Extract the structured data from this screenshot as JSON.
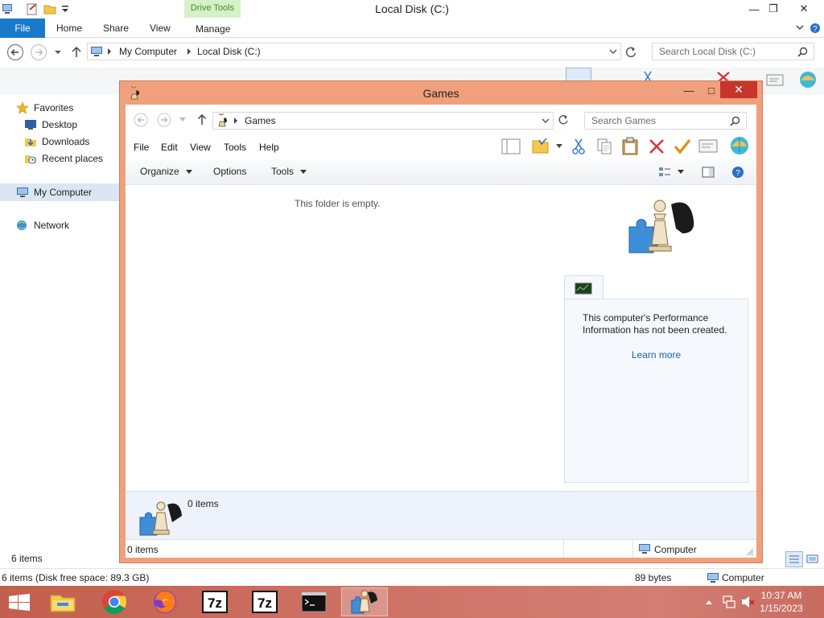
{
  "background_window": {
    "title": "Local Disk (C:)",
    "ribbon": {
      "file_tab": "File",
      "tabs": [
        "Home",
        "Share",
        "View",
        "Manage"
      ],
      "contextual_group": "Drive Tools"
    },
    "address": {
      "crumbs": [
        "My Computer",
        "Local Disk (C:)"
      ],
      "search_placeholder": "Search Local Disk (C:)"
    },
    "nav": {
      "favorites": "Favorites",
      "desktop": "Desktop",
      "downloads": "Downloads",
      "recent_places": "Recent places",
      "my_computer": "My Computer",
      "network": "Network"
    },
    "status": {
      "items_count": "6 items",
      "details_left": "6 items (Disk free space: 89.3 GB)",
      "details_size": "89 bytes",
      "details_location": "Computer"
    }
  },
  "games_window": {
    "title": "Games",
    "address": {
      "crumb": "Games",
      "search_placeholder": "Search Games"
    },
    "menu": [
      "File",
      "Edit",
      "View",
      "Tools",
      "Help"
    ],
    "commands": {
      "organize": "Organize",
      "options": "Options",
      "tools": "Tools"
    },
    "empty_message": "This folder is empty.",
    "performance": {
      "message": "This computer's Performance Information has not been created.",
      "link": "Learn more"
    },
    "details_items": "0 items",
    "status_items": "0 items",
    "status_location": "Computer"
  },
  "taskbar": {
    "apps": [
      "file-explorer",
      "chrome",
      "firefox",
      "7-zip",
      "7-zip",
      "command-prompt",
      "games"
    ],
    "clock_time": "10:37 AM",
    "clock_date": "1/15/2023"
  },
  "colors": {
    "accent": "#1979ca",
    "games_frame": "#f0a07c",
    "close_button": "#c7352b",
    "taskbar": "#ce7265"
  }
}
